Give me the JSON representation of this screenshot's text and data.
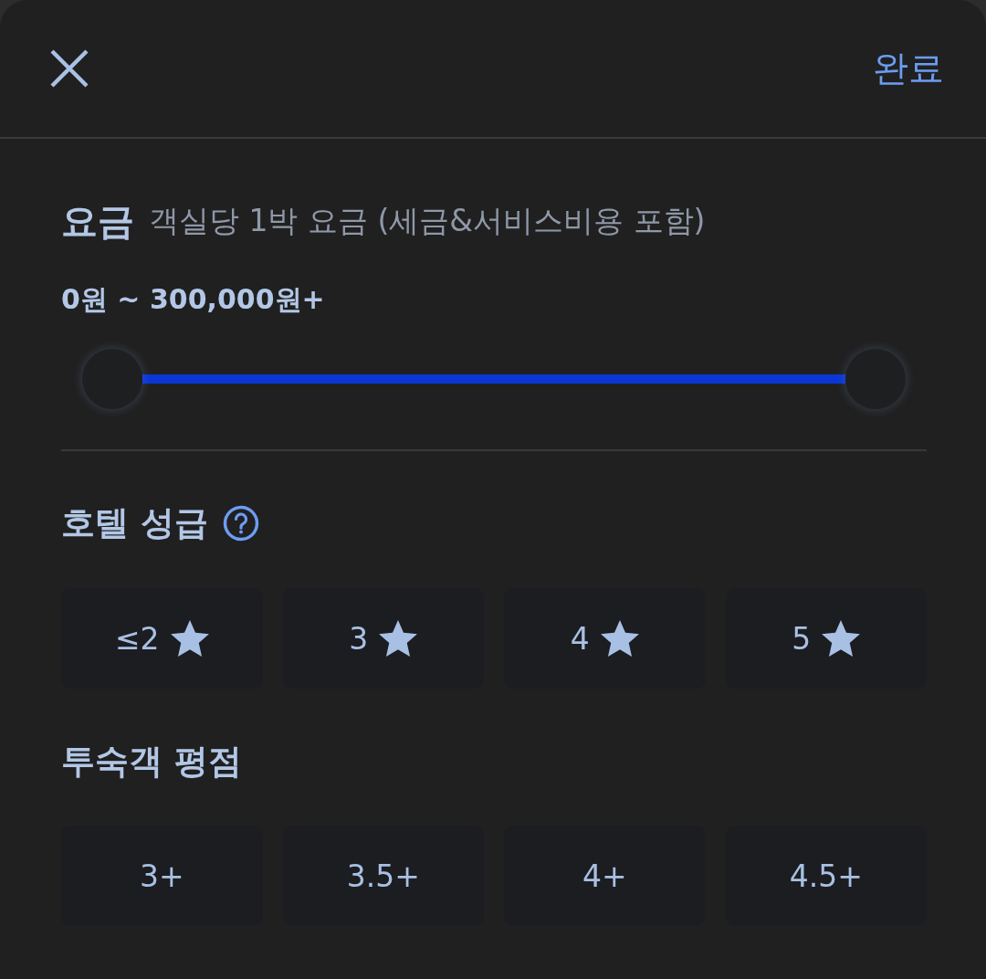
{
  "header": {
    "done": "완료"
  },
  "price": {
    "title": "요금",
    "subtitle": "객실당 1박 요금 (세금&서비스비용 포함)",
    "range": "0원 ~ 300,000원+",
    "thumbs": [
      {
        "level": 0
      },
      {
        "level": 1
      }
    ]
  },
  "hotel_class": {
    "title": "호텔 성급",
    "options": [
      {
        "label": "≤2",
        "selected": false
      },
      {
        "label": "3",
        "selected": false
      },
      {
        "label": "4",
        "selected": false
      },
      {
        "label": "5",
        "selected": false
      }
    ]
  },
  "guest_rating": {
    "title": "투숙객 평점",
    "options": [
      {
        "label": "3+",
        "selected": false
      },
      {
        "label": "3.5+",
        "selected": false
      },
      {
        "label": "4+",
        "selected": false
      },
      {
        "label": "4.5+",
        "selected": false
      }
    ]
  }
}
